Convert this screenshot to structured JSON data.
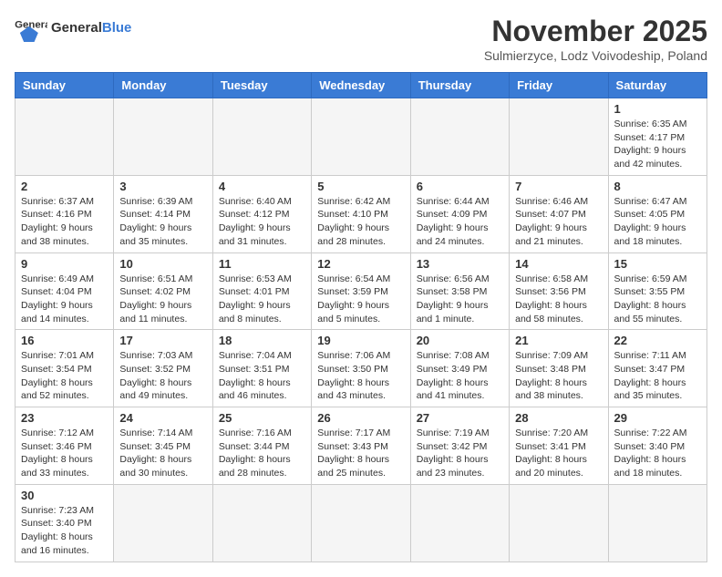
{
  "header": {
    "logo_general": "General",
    "logo_blue": "Blue",
    "month_title": "November 2025",
    "subtitle": "Sulmierzyce, Lodz Voivodeship, Poland"
  },
  "weekdays": [
    "Sunday",
    "Monday",
    "Tuesday",
    "Wednesday",
    "Thursday",
    "Friday",
    "Saturday"
  ],
  "weeks": [
    [
      {
        "day": "",
        "info": ""
      },
      {
        "day": "",
        "info": ""
      },
      {
        "day": "",
        "info": ""
      },
      {
        "day": "",
        "info": ""
      },
      {
        "day": "",
        "info": ""
      },
      {
        "day": "",
        "info": ""
      },
      {
        "day": "1",
        "info": "Sunrise: 6:35 AM\nSunset: 4:17 PM\nDaylight: 9 hours and 42 minutes."
      }
    ],
    [
      {
        "day": "2",
        "info": "Sunrise: 6:37 AM\nSunset: 4:16 PM\nDaylight: 9 hours and 38 minutes."
      },
      {
        "day": "3",
        "info": "Sunrise: 6:39 AM\nSunset: 4:14 PM\nDaylight: 9 hours and 35 minutes."
      },
      {
        "day": "4",
        "info": "Sunrise: 6:40 AM\nSunset: 4:12 PM\nDaylight: 9 hours and 31 minutes."
      },
      {
        "day": "5",
        "info": "Sunrise: 6:42 AM\nSunset: 4:10 PM\nDaylight: 9 hours and 28 minutes."
      },
      {
        "day": "6",
        "info": "Sunrise: 6:44 AM\nSunset: 4:09 PM\nDaylight: 9 hours and 24 minutes."
      },
      {
        "day": "7",
        "info": "Sunrise: 6:46 AM\nSunset: 4:07 PM\nDaylight: 9 hours and 21 minutes."
      },
      {
        "day": "8",
        "info": "Sunrise: 6:47 AM\nSunset: 4:05 PM\nDaylight: 9 hours and 18 minutes."
      }
    ],
    [
      {
        "day": "9",
        "info": "Sunrise: 6:49 AM\nSunset: 4:04 PM\nDaylight: 9 hours and 14 minutes."
      },
      {
        "day": "10",
        "info": "Sunrise: 6:51 AM\nSunset: 4:02 PM\nDaylight: 9 hours and 11 minutes."
      },
      {
        "day": "11",
        "info": "Sunrise: 6:53 AM\nSunset: 4:01 PM\nDaylight: 9 hours and 8 minutes."
      },
      {
        "day": "12",
        "info": "Sunrise: 6:54 AM\nSunset: 3:59 PM\nDaylight: 9 hours and 5 minutes."
      },
      {
        "day": "13",
        "info": "Sunrise: 6:56 AM\nSunset: 3:58 PM\nDaylight: 9 hours and 1 minute."
      },
      {
        "day": "14",
        "info": "Sunrise: 6:58 AM\nSunset: 3:56 PM\nDaylight: 8 hours and 58 minutes."
      },
      {
        "day": "15",
        "info": "Sunrise: 6:59 AM\nSunset: 3:55 PM\nDaylight: 8 hours and 55 minutes."
      }
    ],
    [
      {
        "day": "16",
        "info": "Sunrise: 7:01 AM\nSunset: 3:54 PM\nDaylight: 8 hours and 52 minutes."
      },
      {
        "day": "17",
        "info": "Sunrise: 7:03 AM\nSunset: 3:52 PM\nDaylight: 8 hours and 49 minutes."
      },
      {
        "day": "18",
        "info": "Sunrise: 7:04 AM\nSunset: 3:51 PM\nDaylight: 8 hours and 46 minutes."
      },
      {
        "day": "19",
        "info": "Sunrise: 7:06 AM\nSunset: 3:50 PM\nDaylight: 8 hours and 43 minutes."
      },
      {
        "day": "20",
        "info": "Sunrise: 7:08 AM\nSunset: 3:49 PM\nDaylight: 8 hours and 41 minutes."
      },
      {
        "day": "21",
        "info": "Sunrise: 7:09 AM\nSunset: 3:48 PM\nDaylight: 8 hours and 38 minutes."
      },
      {
        "day": "22",
        "info": "Sunrise: 7:11 AM\nSunset: 3:47 PM\nDaylight: 8 hours and 35 minutes."
      }
    ],
    [
      {
        "day": "23",
        "info": "Sunrise: 7:12 AM\nSunset: 3:46 PM\nDaylight: 8 hours and 33 minutes."
      },
      {
        "day": "24",
        "info": "Sunrise: 7:14 AM\nSunset: 3:45 PM\nDaylight: 8 hours and 30 minutes."
      },
      {
        "day": "25",
        "info": "Sunrise: 7:16 AM\nSunset: 3:44 PM\nDaylight: 8 hours and 28 minutes."
      },
      {
        "day": "26",
        "info": "Sunrise: 7:17 AM\nSunset: 3:43 PM\nDaylight: 8 hours and 25 minutes."
      },
      {
        "day": "27",
        "info": "Sunrise: 7:19 AM\nSunset: 3:42 PM\nDaylight: 8 hours and 23 minutes."
      },
      {
        "day": "28",
        "info": "Sunrise: 7:20 AM\nSunset: 3:41 PM\nDaylight: 8 hours and 20 minutes."
      },
      {
        "day": "29",
        "info": "Sunrise: 7:22 AM\nSunset: 3:40 PM\nDaylight: 8 hours and 18 minutes."
      }
    ],
    [
      {
        "day": "30",
        "info": "Sunrise: 7:23 AM\nSunset: 3:40 PM\nDaylight: 8 hours and 16 minutes."
      },
      {
        "day": "",
        "info": ""
      },
      {
        "day": "",
        "info": ""
      },
      {
        "day": "",
        "info": ""
      },
      {
        "day": "",
        "info": ""
      },
      {
        "day": "",
        "info": ""
      },
      {
        "day": "",
        "info": ""
      }
    ]
  ]
}
